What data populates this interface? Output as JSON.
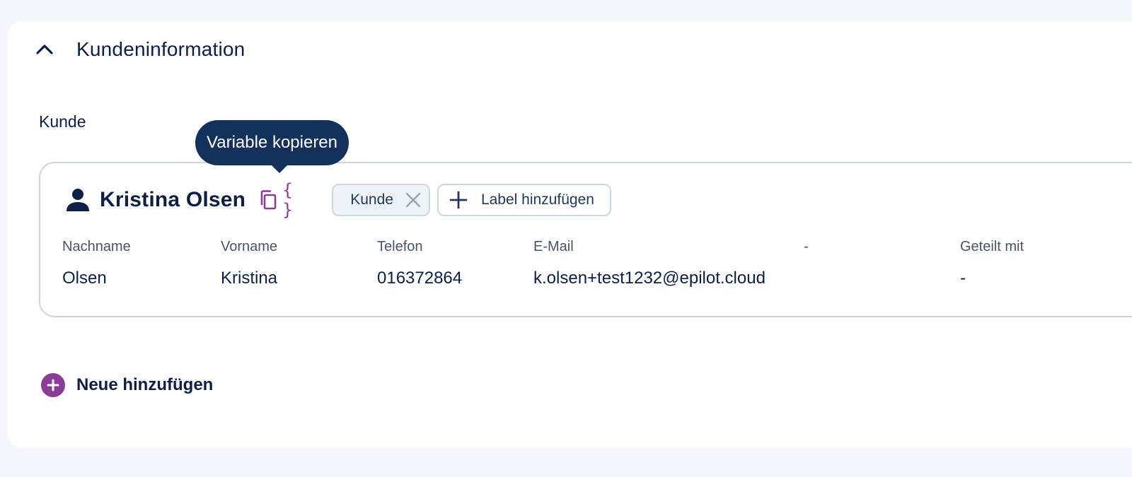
{
  "section": {
    "title": "Kundeninformation",
    "expanded": true
  },
  "group": {
    "label": "Kunde"
  },
  "contact": {
    "name": "Kristina Olsen",
    "labels": [
      {
        "text": "Kunde"
      }
    ],
    "add_label_text": "Label hinzufügen",
    "fields": [
      {
        "label": "Nachname",
        "value": "Olsen"
      },
      {
        "label": "Vorname",
        "value": "Kristina"
      },
      {
        "label": "Telefon",
        "value": "016372864"
      },
      {
        "label": "E-Mail",
        "value": "k.olsen+test1232@epilot.cloud"
      },
      {
        "label": "-",
        "value": ""
      },
      {
        "label": "Geteilt mit",
        "value": "-"
      }
    ]
  },
  "variable_icon_text": "{ }",
  "tooltip": {
    "text": "Variable kopieren"
  },
  "add_new": {
    "label": "Neue hinzufügen"
  },
  "icons": {
    "chevron": "chevron-up-icon",
    "person": "person-icon",
    "copy": "copy-icon",
    "variable": "curly-braces-icon",
    "close": "close-icon",
    "plus": "plus-icon"
  },
  "colors": {
    "background": "#f5f6fe",
    "panel": "#ffffff",
    "text_primary": "#0d1f45",
    "accent_purple": "#8a3c96",
    "tooltip_bg": "#13315c",
    "chip_bg": "#eef3f8",
    "border": "#cfd3da"
  }
}
